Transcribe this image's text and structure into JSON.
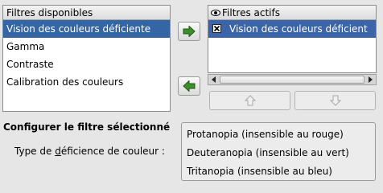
{
  "available": {
    "header": "Filtres disponibles",
    "items": [
      {
        "label": "Vision des couleurs déficiente",
        "selected": true
      },
      {
        "label": "Gamma",
        "selected": false
      },
      {
        "label": "Contraste",
        "selected": false
      },
      {
        "label": "Calibration des couleurs",
        "selected": false
      }
    ]
  },
  "active": {
    "header": "Filtres actifs",
    "items": [
      {
        "label": "Vision des couleurs déficient",
        "checked": true
      }
    ]
  },
  "configure": {
    "title": "Configurer le filtre sélectionné",
    "label_before": "Type de ",
    "label_mnemonic": "d",
    "label_after": "éficience de couleur :",
    "options": [
      "Protanopia (insensible au rouge)",
      "Deuteranopia (insensible au vert)",
      "Tritanopia (insensible au bleu)"
    ]
  },
  "icons": {
    "add": "arrow-right-icon",
    "remove": "arrow-left-icon",
    "up": "arrow-up-icon",
    "down": "arrow-down-icon",
    "visibility": "eye-icon"
  },
  "colors": {
    "selection": "#3465a4",
    "arrow_green": "#3d8f2c",
    "background": "#e6e6e6"
  }
}
